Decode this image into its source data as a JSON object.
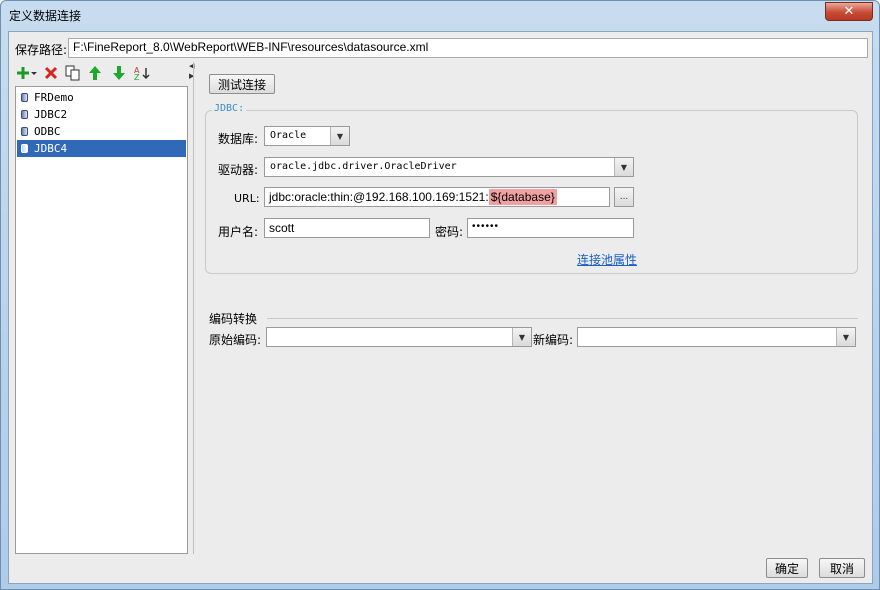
{
  "window": {
    "title": "定义数据连接",
    "close_label": "✕"
  },
  "path": {
    "label": "保存路径:",
    "value": "F:\\FineReport_8.0\\WebReport\\WEB-INF\\resources\\datasource.xml"
  },
  "toolbar": {
    "add": "+▾",
    "delete": "✕",
    "copy": "copy",
    "up": "up",
    "down": "down",
    "sort": "z↓"
  },
  "datasources": [
    {
      "name": "FRDemo",
      "selected": false
    },
    {
      "name": "JDBC2",
      "selected": false
    },
    {
      "name": "ODBC",
      "selected": false
    },
    {
      "name": "JDBC4",
      "selected": true
    }
  ],
  "test_button": "测试连接",
  "jdbc": {
    "group_title": "JDBC:",
    "database_label": "数据库:",
    "database_value": "Oracle",
    "driver_label": "驱动器:",
    "driver_value": "oracle.jdbc.driver.OracleDriver",
    "url_label": "URL:",
    "url_prefix": "jdbc:oracle:thin:@192.168.100.169:1521:",
    "url_highlight": "${database}",
    "url_button": "...",
    "user_label": "用户名:",
    "user_value": "scott",
    "password_label": "密码:",
    "password_value": "••••••",
    "pool_link": "连接池属性"
  },
  "encoding": {
    "section_title": "编码转换",
    "original_label": "原始编码:",
    "original_value": "",
    "new_label": "新编码:",
    "new_value": ""
  },
  "footer": {
    "ok": "确定",
    "cancel": "取消"
  },
  "colors": {
    "selection": "#3069b8",
    "highlight": "#f0a0a0",
    "link": "#1a5ec9",
    "group_title": "#3a8fc4"
  }
}
